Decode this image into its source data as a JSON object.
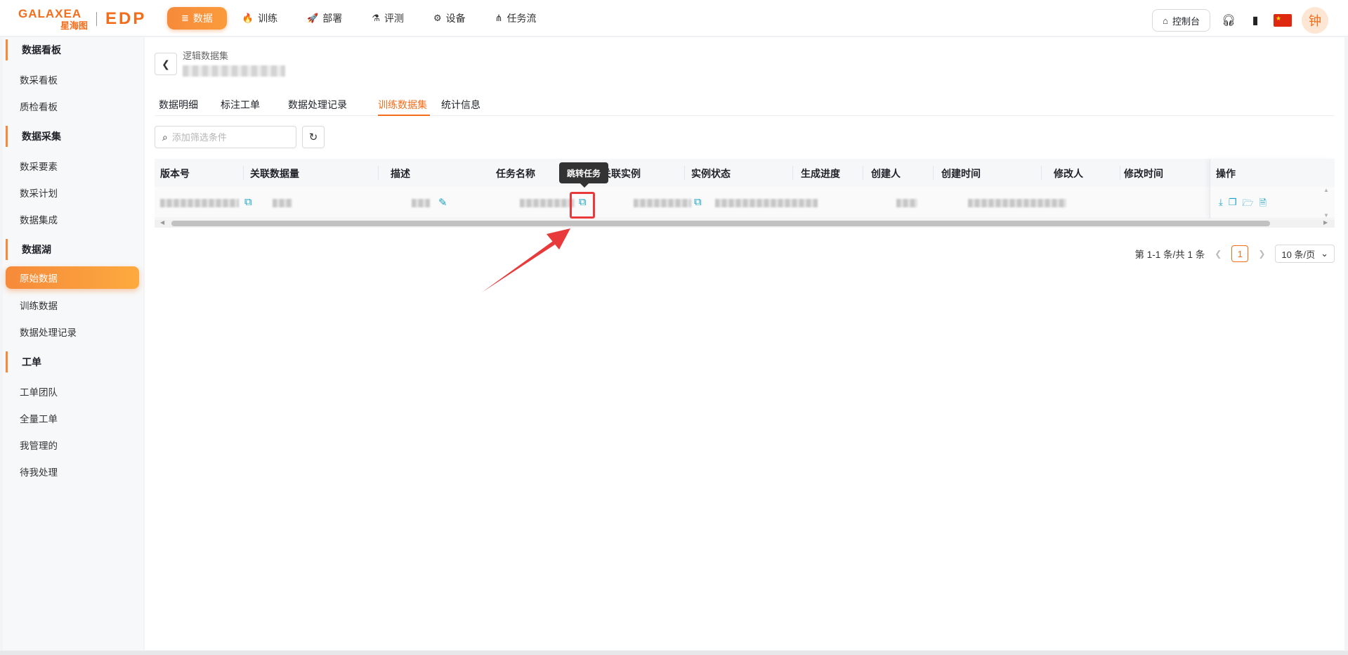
{
  "logo": {
    "en": "GALAXEA",
    "cn": "星海图",
    "product": "EDP"
  },
  "nav": [
    {
      "label": "数据",
      "icon": "≣",
      "active": true
    },
    {
      "label": "训练",
      "icon": "🔥"
    },
    {
      "label": "部署",
      "icon": "🚀"
    },
    {
      "label": "评测",
      "icon": "⚗"
    },
    {
      "label": "设备",
      "icon": "⚙"
    },
    {
      "label": "任务流",
      "icon": "⋔"
    }
  ],
  "top_right": {
    "console": "控制台",
    "avatar": "钟"
  },
  "sidebar": {
    "groups": [
      "数据看板",
      "数据采集",
      "数据湖",
      "工单"
    ],
    "items": [
      "数采看板",
      "质检看板",
      "数采要素",
      "数采计划",
      "数据集成",
      "原始数据",
      "训练数据",
      "数据处理记录",
      "工单团队",
      "全量工单",
      "我管理的",
      "待我处理"
    ]
  },
  "breadcrumb": {
    "title": "逻辑数据集"
  },
  "tabs": [
    "数据明细",
    "标注工单",
    "数据处理记录",
    "训练数据集",
    "统计信息"
  ],
  "search": {
    "placeholder": "添加筛选条件"
  },
  "table": {
    "headers": [
      "版本号",
      "关联数据量",
      "描述",
      "任务名称",
      "关联实例",
      "实例状态",
      "生成进度",
      "创建人",
      "创建时间",
      "修改人",
      "修改时间",
      "操作"
    ]
  },
  "tooltip": "跳转任务",
  "pagination": {
    "summary": "第 1-1 条/共 1 条",
    "current": "1",
    "page_size": "10 条/页"
  },
  "colors": {
    "accent": "#f46d1b",
    "link": "#18a0c8",
    "highlight": "#e83a3a"
  }
}
